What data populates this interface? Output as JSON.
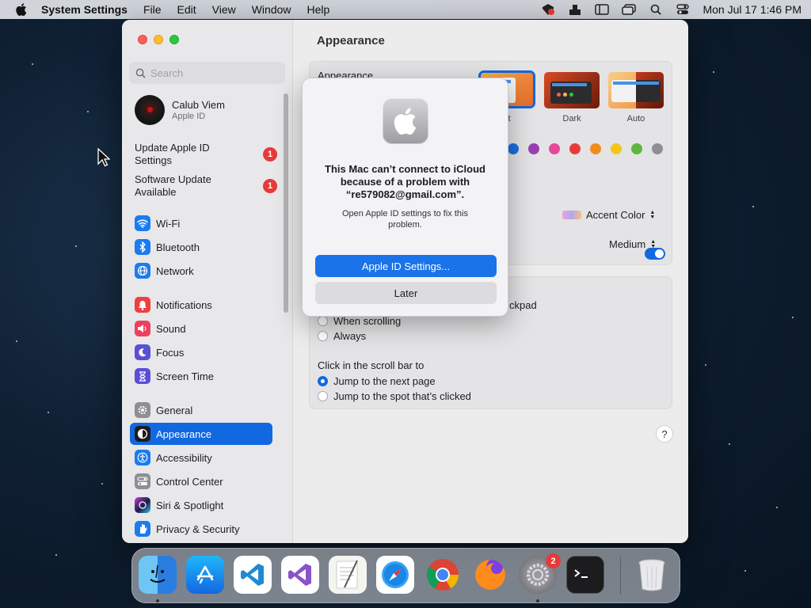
{
  "menubar": {
    "app_name": "System Settings",
    "menus": [
      "File",
      "Edit",
      "View",
      "Window",
      "Help"
    ],
    "datetime": "Mon Jul 17  1:46 PM"
  },
  "sidebar": {
    "search_placeholder": "Search",
    "account": {
      "name": "Calub Viem",
      "subtitle": "Apple ID"
    },
    "notices": [
      {
        "label": "Update Apple ID Settings",
        "badge": "1"
      },
      {
        "label": "Software Update Available",
        "badge": "1"
      }
    ],
    "items": [
      {
        "label": "Wi-Fi"
      },
      {
        "label": "Bluetooth"
      },
      {
        "label": "Network"
      },
      {
        "label": "Notifications"
      },
      {
        "label": "Sound"
      },
      {
        "label": "Focus"
      },
      {
        "label": "Screen Time"
      },
      {
        "label": "General"
      },
      {
        "label": "Appearance",
        "selected": true
      },
      {
        "label": "Accessibility"
      },
      {
        "label": "Control Center"
      },
      {
        "label": "Siri & Spotlight"
      },
      {
        "label": "Privacy & Security"
      }
    ]
  },
  "main": {
    "title": "Appearance",
    "appearance_label": "Appearance",
    "appearance_options": [
      {
        "label": "ht",
        "selected": true
      },
      {
        "label": "Dark"
      },
      {
        "label": "Auto"
      }
    ],
    "accent_fragment": "or",
    "accent_colors": [
      "#1a6fe0",
      "#9b3fb0",
      "#e5489a",
      "#e63b3b",
      "#f08c1e",
      "#f5c51d",
      "#5cb83e",
      "#8e8e93"
    ],
    "highlight_value": "Accent Color",
    "sidebar_icon_size_value": "Medium",
    "scrollbar_fragment": "ckpad",
    "scroll_options": [
      {
        "label": "When scrolling",
        "selected": false
      },
      {
        "label": "Always",
        "selected": false
      }
    ],
    "click_label": "Click in the scroll bar to",
    "click_options": [
      {
        "label": "Jump to the next page",
        "selected": true
      },
      {
        "label": "Jump to the spot that’s clicked",
        "selected": false
      }
    ],
    "help_label": "?"
  },
  "alert": {
    "title": "This Mac can’t connect to iCloud because of a problem with “re579082@gmail.com”.",
    "message": "Open Apple ID settings to fix this problem.",
    "primary_button": "Apple ID Settings...",
    "secondary_button": "Later"
  },
  "dock": {
    "apps": [
      "Finder",
      "App Store",
      "Visual Studio Code",
      "Visual Studio",
      "TextEdit",
      "Safari",
      "Google Chrome",
      "Firefox",
      "System Settings",
      "Terminal",
      "Trash"
    ],
    "settings_badge": "2"
  },
  "colors": {
    "accent": "#1168e0",
    "badge_red": "#e8393a"
  }
}
